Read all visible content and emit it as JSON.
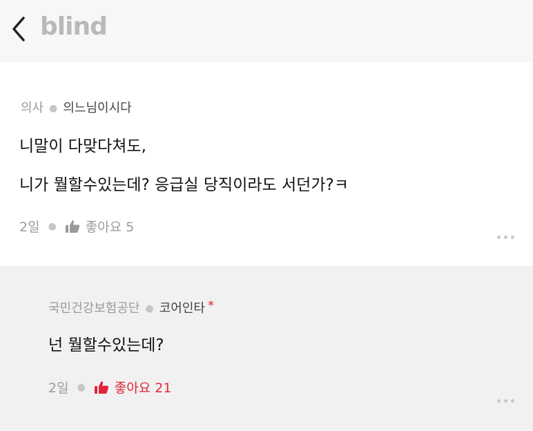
{
  "header": {
    "logo": "blind"
  },
  "comment": {
    "company": "의사",
    "nickname": "의느님이시다",
    "lines": [
      "니말이 다맞다쳐도,",
      "니가 뭘할수있는데? 응급실 당직이라도 서던가?ㅋ"
    ],
    "time": "2일",
    "like_label": "좋아요 5"
  },
  "reply": {
    "company": "국민건강보험공단",
    "nickname": "코어인타",
    "author_mark": "*",
    "text": "넌 뭘할수있는데?",
    "time": "2일",
    "like_label": "좋아요 21"
  },
  "colors": {
    "accent": "#e2243a",
    "muted": "#9a9a9a",
    "logo": "#b9b9b9"
  }
}
